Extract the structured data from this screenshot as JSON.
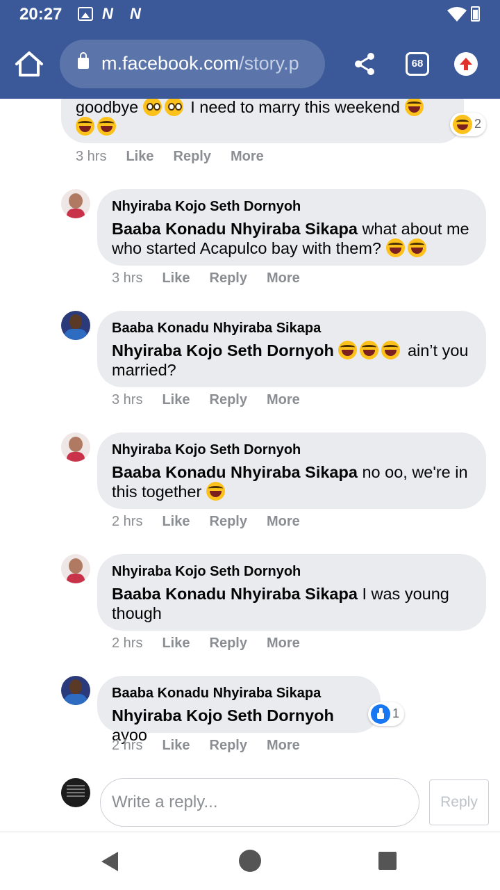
{
  "status_bar": {
    "time": "20:27",
    "notif_icons": [
      "N",
      "N"
    ]
  },
  "browser": {
    "url_host": "m.facebook.com",
    "url_path": "/story.p",
    "tab_count": "68"
  },
  "top_comment": {
    "text": "goodbye",
    "text_2": " I need to marry this weekend ",
    "reaction_count": "2",
    "time": "3 hrs"
  },
  "actions": {
    "like": "Like",
    "reply": "Reply",
    "more": "More"
  },
  "replies": [
    {
      "author": "Nhyiraba Kojo Seth Dornyoh",
      "mention": "Baaba Konadu Nhyiraba Sikapa",
      "text": " what about me who started Acapulco bay with them? ",
      "time": "3 hrs"
    },
    {
      "author": "Baaba Konadu Nhyiraba Sikapa",
      "mention": "Nhyiraba Kojo Seth Dornyoh",
      "text": " ain’t you married?",
      "time": "3 hrs"
    },
    {
      "author": "Nhyiraba Kojo Seth Dornyoh",
      "mention": "Baaba Konadu Nhyiraba Sikapa",
      "text": " no oo, we're in this together ",
      "time": "2 hrs"
    },
    {
      "author": "Nhyiraba Kojo Seth Dornyoh",
      "mention": "Baaba Konadu Nhyiraba Sikapa",
      "text": " I was young though",
      "time": "2 hrs"
    },
    {
      "author": "Baaba Konadu Nhyiraba Sikapa",
      "mention": "Nhyiraba Kojo Seth Dornyoh",
      "text": " ayoo",
      "time": "2 hrs",
      "reaction_count": "1"
    }
  ],
  "composer": {
    "placeholder": "Write a reply...",
    "submit_label": "Reply"
  },
  "colors": {
    "brand": "#3b5998",
    "bubble": "#e9ebee",
    "meta": "#8a8d91",
    "like_blue": "#1877f2"
  }
}
